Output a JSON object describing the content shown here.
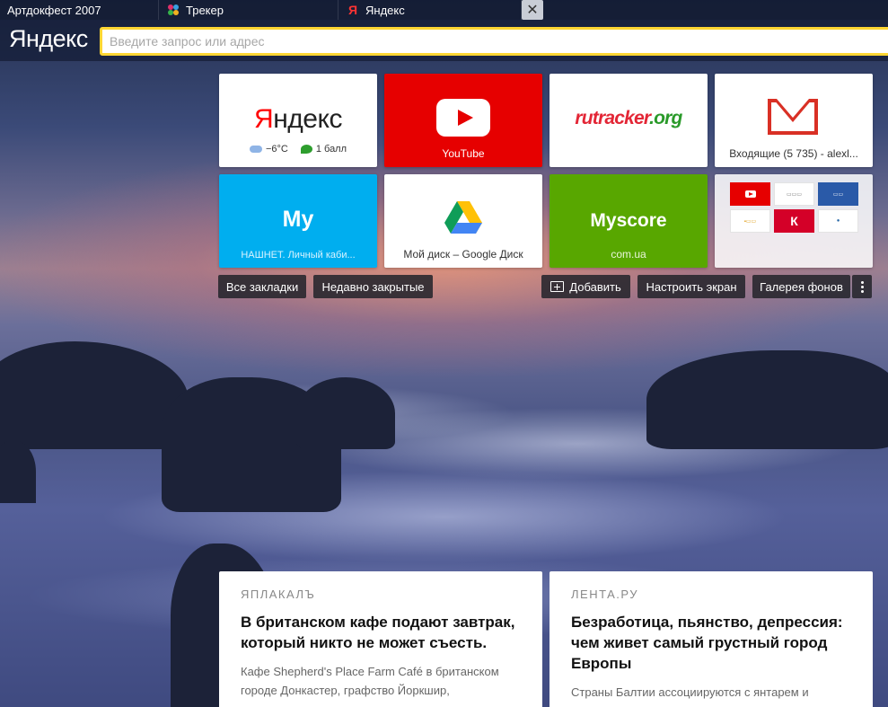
{
  "tabs": [
    {
      "label": "Артдокфест 2007",
      "icon": "none"
    },
    {
      "label": "Трекер",
      "icon": "tracker-icon"
    },
    {
      "label": "Яндекс",
      "icon": "yandex-icon"
    }
  ],
  "header": {
    "logo": "Яндекс",
    "search_placeholder": "Введите запрос или адрес"
  },
  "tiles": {
    "yandex": {
      "logo_first": "Я",
      "logo_rest": "ндекс",
      "temp": "−6°C",
      "score": "1 балл"
    },
    "youtube": {
      "caption": "YouTube"
    },
    "rutracker": {
      "logo_a": "rutracker",
      "logo_b": ".org"
    },
    "gmail": {
      "caption": "Входящие (5 735) - alexl..."
    },
    "my": {
      "word": "My",
      "caption": "НАШНЕТ. Личный каби..."
    },
    "gdrive": {
      "caption": "Мой диск – Google Диск"
    },
    "myscore": {
      "word": "Myscore",
      "caption": "com.ua"
    },
    "more": {
      "mini_labels": [
        "",
        "",
        "",
        "",
        "К",
        ""
      ]
    }
  },
  "buttons": {
    "bookmarks": "Все закладки",
    "recent": "Недавно закрытые",
    "add": "Добавить",
    "customize": "Настроить экран",
    "gallery": "Галерея фонов"
  },
  "news": [
    {
      "source": "ЯПЛАКАЛЪ",
      "title": "В британском кафе подают завтрак, который никто не может съесть.",
      "text": "Кафе Shepherd's Place Farm Café в британском городе Донкастер, графство Йоркшир,"
    },
    {
      "source": "ЛЕНТА.РУ",
      "title": "Безработица, пьянство, депрессия: чем живет самый грустный город Европы",
      "text": "Страны Балтии ассоциируются с янтарем и"
    }
  ],
  "colors": {
    "accent": "#ffd633",
    "youtube": "#e60000",
    "my": "#00aeef",
    "myscore": "#58a700"
  }
}
